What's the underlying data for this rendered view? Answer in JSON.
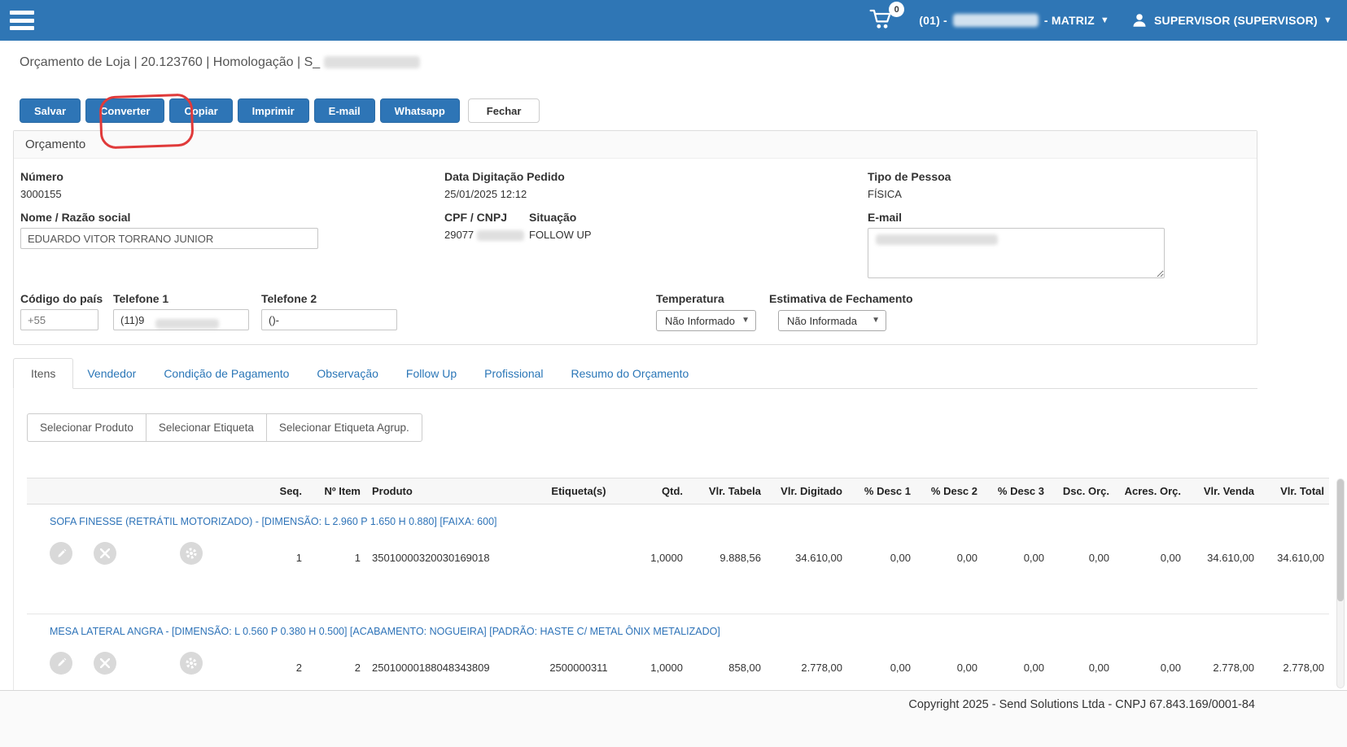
{
  "colors": {
    "topbar_blue": "#2f76b5",
    "button_blue": "#2e75b6",
    "link_blue": "#2a76b7",
    "product_blue": "#2e73b8",
    "annotation_red": "#e03a3a"
  },
  "topbar": {
    "cart_count": "0",
    "branch_prefix": "(01) -",
    "branch_suffix": "- MATRIZ",
    "user_label": "SUPERVISOR (SUPERVISOR)"
  },
  "breadcrumb": "Orçamento de Loja | 20.123760 | Homologação | S_",
  "toolbar": {
    "salvar": "Salvar",
    "converter": "Converter",
    "copiar": "Copiar",
    "imprimir": "Imprimir",
    "email": "E-mail",
    "whatsapp": "Whatsapp",
    "fechar": "Fechar"
  },
  "orcamento": {
    "panel_title": "Orçamento",
    "numero_label": "Número",
    "numero": "3000155",
    "nome_label": "Nome / Razão social",
    "nome": "EDUARDO VITOR TORRANO JUNIOR",
    "data_label": "Data Digitação Pedido",
    "data": "25/01/2025 12:12",
    "cpf_label": "CPF / CNPJ",
    "cpf": "29077",
    "situacao_label": "Situação",
    "situacao": "FOLLOW UP",
    "tipo_label": "Tipo de Pessoa",
    "tipo": "FÍSICA",
    "email_label": "E-mail",
    "codigo_pais_label": "Código do país",
    "codigo_pais_placeholder": "+55",
    "tel1_label": "Telefone 1",
    "tel1": "(11)9",
    "tel2_label": "Telefone 2",
    "tel2": "()-",
    "temperatura_label": "Temperatura",
    "temperatura": "Não Informado",
    "estimativa_label": "Estimativa de Fechamento",
    "estimativa": "Não Informada"
  },
  "tabs": {
    "itens": "Itens",
    "vendedor": "Vendedor",
    "condicao": "Condição de Pagamento",
    "observacao": "Observação",
    "followup": "Follow Up",
    "profissional": "Profissional",
    "resumo": "Resumo do Orçamento"
  },
  "item_buttons": {
    "sel_produto": "Selecionar Produto",
    "sel_etiqueta": "Selecionar Etiqueta",
    "sel_etiqueta_agrup": "Selecionar Etiqueta Agrup."
  },
  "table": {
    "headers": [
      "",
      "Seq.",
      "Nº Item",
      "Produto",
      "Etiqueta(s)",
      "Qtd.",
      "Vlr. Tabela",
      "Vlr. Digitado",
      "% Desc 1",
      "% Desc 2",
      "% Desc 3",
      "Dsc. Orç.",
      "Acres. Orç.",
      "Vlr. Venda",
      "Vlr. Total"
    ],
    "items": [
      {
        "descricao": "SOFA FINESSE (RETRÁTIL MOTORIZADO) - [DIMENSÃO: L 2.960 P 1.650 H 0.880] [FAIXA: 600]",
        "seq": "1",
        "n_item": "1",
        "produto": "35010000320030169018",
        "etiqueta": "",
        "qtd": "1,0000",
        "vlr_tabela": "9.888,56",
        "vlr_digitado": "34.610,00",
        "desc1": "0,00",
        "desc2": "0,00",
        "desc3": "0,00",
        "dsc_orc": "0,00",
        "acres_orc": "0,00",
        "vlr_venda": "34.610,00",
        "vlr_total": "34.610,00"
      },
      {
        "descricao": "MESA LATERAL ANGRA - [DIMENSÃO: L 0.560 P 0.380 H 0.500] [ACABAMENTO: NOGUEIRA] [PADRÃO: HASTE C/ METAL ÔNIX METALIZADO]",
        "seq": "2",
        "n_item": "2",
        "produto": "25010000188048343809",
        "etiqueta": "2500000311",
        "qtd": "1,0000",
        "vlr_tabela": "858,00",
        "vlr_digitado": "2.778,00",
        "desc1": "0,00",
        "desc2": "0,00",
        "desc3": "0,00",
        "dsc_orc": "0,00",
        "acres_orc": "0,00",
        "vlr_venda": "2.778,00",
        "vlr_total": "2.778,00"
      }
    ]
  },
  "footer": "Copyright 2025 - Send Solutions Ltda - CNPJ 67.843.169/0001-84"
}
